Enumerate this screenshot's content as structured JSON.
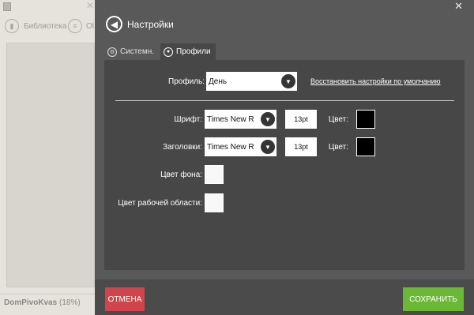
{
  "background_app": {
    "library_label": "Библиотека",
    "other_label": "Ol",
    "book_name": "DomPivoKvas",
    "book_progress": "(18%)"
  },
  "dialog": {
    "title": "Настройки",
    "close_glyph": "✕",
    "tabs": [
      {
        "label": "Системн.",
        "active": false
      },
      {
        "label": "Профили",
        "active": true
      }
    ],
    "profile": {
      "label": "Профиль:",
      "value": "День",
      "reset_link": "Восстановить настройки по умолчанию"
    },
    "font": {
      "label": "Шрифт:",
      "value": "Times New R",
      "size": "13pt",
      "color_label": "Цвет:",
      "color": "#000000"
    },
    "headings": {
      "label": "Заголовки:",
      "value": "Times New R",
      "size": "13pt",
      "color_label": "Цвет:",
      "color": "#000000"
    },
    "background_color": {
      "label": "Цвет фона:",
      "color": "#f8f8f8"
    },
    "workspace_color": {
      "label": "Цвет рабочей области:",
      "color": "#f8f8f8"
    },
    "cancel_label": "ОТМЕНА",
    "save_label": "СОХРАНИТЬ"
  },
  "colors": {
    "dialog_bg": "#595959",
    "content_bg": "#474747",
    "cancel": "#d0444b",
    "save": "#6bb834"
  }
}
